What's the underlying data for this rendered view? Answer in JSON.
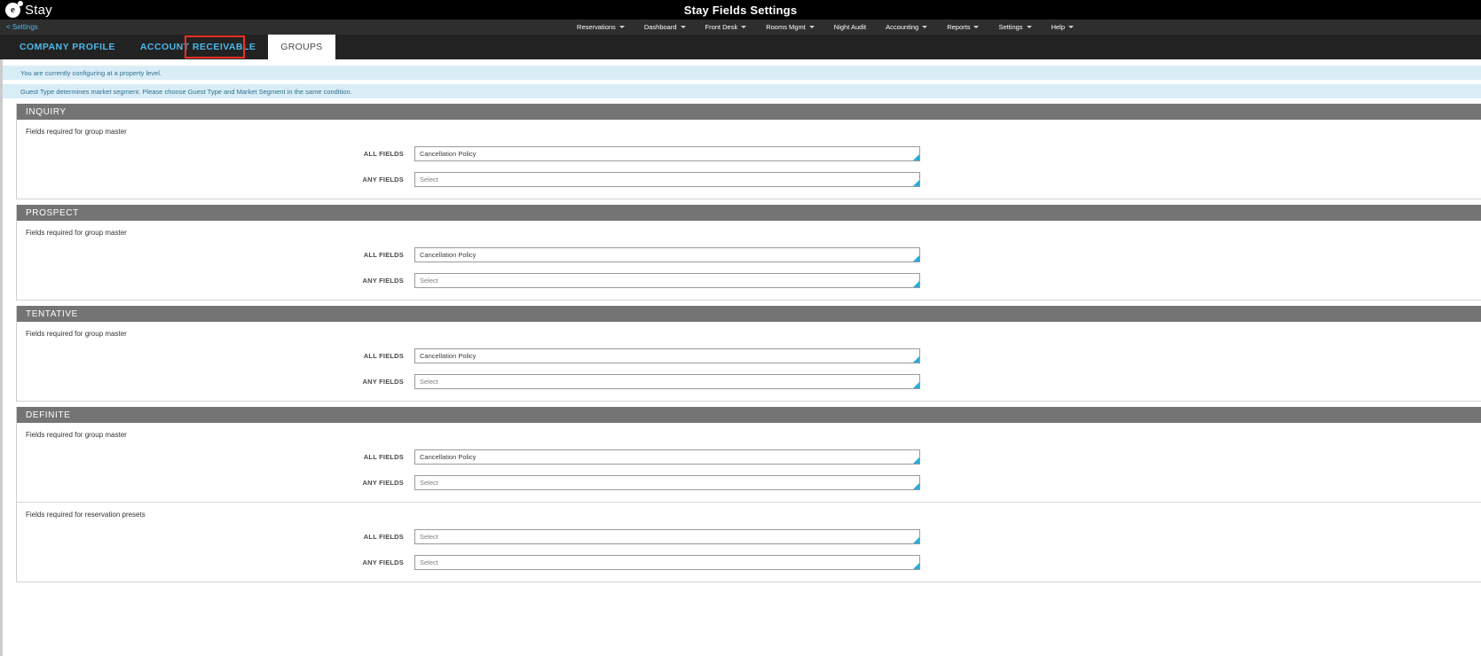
{
  "topbar": {
    "logo_letter": "e",
    "logo_text": "Stay",
    "title": "Stay Fields Settings"
  },
  "nav": {
    "breadcrumb": "< Settings",
    "items": [
      {
        "label": "Reservations",
        "caret": true
      },
      {
        "label": "Dashboard",
        "caret": true
      },
      {
        "label": "Front Desk",
        "caret": true
      },
      {
        "label": "Rooms Mgmt",
        "caret": true
      },
      {
        "label": "Night Audit",
        "caret": false
      },
      {
        "label": "Accounting",
        "caret": true
      },
      {
        "label": "Reports",
        "caret": true
      },
      {
        "label": "Settings",
        "caret": true
      },
      {
        "label": "Help",
        "caret": true
      }
    ]
  },
  "tabs": [
    {
      "label": "COMPANY PROFILE",
      "active": false
    },
    {
      "label": "ACCOUNT RECEIVABLE",
      "active": false
    },
    {
      "label": "GROUPS",
      "active": true
    }
  ],
  "notices": [
    "You are currently configuring at a property level.",
    "Guest Type determines market segment. Please choose Guest Type and Market Segment in the same condition."
  ],
  "labels": {
    "all_fields": "ALL FIELDS",
    "any_fields": "ANY FIELDS",
    "group_master": "Fields required for group master",
    "reservation_presets": "Fields required for reservation presets"
  },
  "values": {
    "cancellation_policy": "Cancellation Policy",
    "select_placeholder": "Select"
  },
  "colors": {
    "accent_link": "#4db8e8",
    "section_header": "#747474",
    "notice_bg": "#d9edf7",
    "notice_text": "#31708f",
    "annotation": "#ee3124",
    "grip": "#29abd6"
  },
  "sections": [
    {
      "title": "INQUIRY",
      "subsections": [
        {
          "title": "Fields required for group master",
          "fields": [
            {
              "label": "ALL FIELDS",
              "value": "Cancellation Policy",
              "is_placeholder": false
            },
            {
              "label": "ANY FIELDS",
              "value": "Select",
              "is_placeholder": true
            }
          ]
        }
      ]
    },
    {
      "title": "PROSPECT",
      "subsections": [
        {
          "title": "Fields required for group master",
          "fields": [
            {
              "label": "ALL FIELDS",
              "value": "Cancellation Policy",
              "is_placeholder": false
            },
            {
              "label": "ANY FIELDS",
              "value": "Select",
              "is_placeholder": true
            }
          ]
        }
      ]
    },
    {
      "title": "TENTATIVE",
      "subsections": [
        {
          "title": "Fields required for group master",
          "fields": [
            {
              "label": "ALL FIELDS",
              "value": "Cancellation Policy",
              "is_placeholder": false
            },
            {
              "label": "ANY FIELDS",
              "value": "Select",
              "is_placeholder": true
            }
          ]
        }
      ]
    },
    {
      "title": "DEFINITE",
      "subsections": [
        {
          "title": "Fields required for group master",
          "fields": [
            {
              "label": "ALL FIELDS",
              "value": "Cancellation Policy",
              "is_placeholder": false
            },
            {
              "label": "ANY FIELDS",
              "value": "Select",
              "is_placeholder": true
            }
          ]
        },
        {
          "title": "Fields required for reservation presets",
          "fields": [
            {
              "label": "ALL FIELDS",
              "value": "Select",
              "is_placeholder": true
            },
            {
              "label": "ANY FIELDS",
              "value": "Select",
              "is_placeholder": true
            }
          ]
        }
      ]
    }
  ]
}
